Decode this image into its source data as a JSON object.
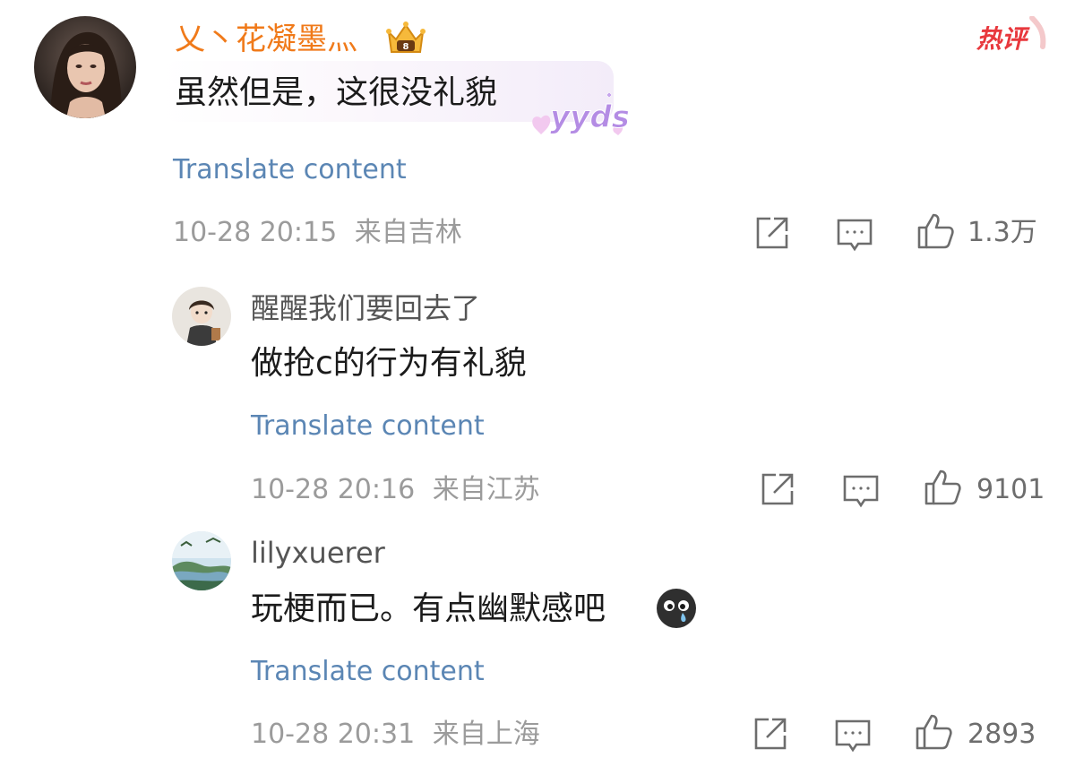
{
  "top_comment": {
    "username": "乂丶花凝墨灬",
    "hot_badge": "热评",
    "text": "虽然但是，这很没礼貌",
    "bubble_sticker": "yyds",
    "translate_label": "Translate content",
    "timestamp": "10-28 20:15",
    "location": "来自吉林",
    "like_count": "1.3万"
  },
  "replies": [
    {
      "username": "醒醒我们要回去了",
      "text": "做抢c的行为有礼貌",
      "translate_label": "Translate content",
      "timestamp": "10-28 20:16",
      "location": "来自江苏",
      "like_count": "9101"
    },
    {
      "username": "lilyxuerer",
      "text": "玩梗而已。有点幽默感吧",
      "emoji": "crying-face-emoji",
      "translate_label": "Translate content",
      "timestamp": "10-28 20:31",
      "location": "来自上海",
      "like_count": "2893"
    }
  ],
  "icons": {
    "share": "share-icon",
    "comment": "comment-icon",
    "like": "thumbs-up-icon",
    "crown": "crown-badge-icon"
  },
  "colors": {
    "username_main": "#f07a1a",
    "hot_badge": "#e8383d",
    "translate_link": "#5b86b4",
    "meta_text": "#9b9b9b"
  }
}
